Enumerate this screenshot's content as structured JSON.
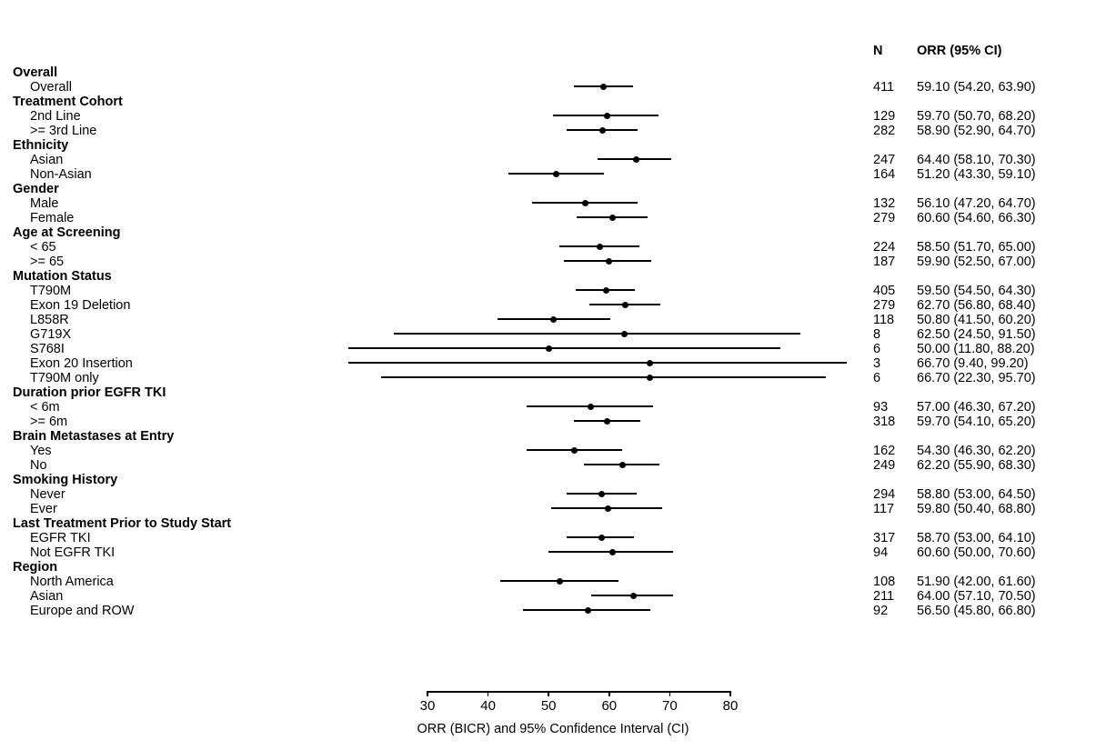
{
  "columns": {
    "n_header": "N",
    "orr_header": "ORR (95% CI)"
  },
  "axis": {
    "title": "ORR (BICR) and 95% Confidence Interval (CI)",
    "ticks": [
      "30",
      "40",
      "50",
      "60",
      "70",
      "80"
    ]
  },
  "chart_data": {
    "type": "forest",
    "title": "",
    "xlabel": "ORR (BICR) and 95% Confidence Interval (CI)",
    "ylabel": "",
    "xlim": [
      30,
      80
    ],
    "xticks": [
      30,
      40,
      50,
      60,
      70,
      80
    ],
    "grid": false,
    "legend": null,
    "columns": [
      "N",
      "ORR (95% CI)"
    ],
    "rows": [
      {
        "type": "group",
        "label": "Overall",
        "n": "",
        "orr_text": "",
        "estimate": null,
        "low": null,
        "high": null
      },
      {
        "type": "item",
        "label": "Overall",
        "n": "411",
        "orr_text": "59.10 (54.20, 63.90)",
        "estimate": 59.1,
        "low": 54.2,
        "high": 63.9
      },
      {
        "type": "group",
        "label": "Treatment Cohort",
        "n": "",
        "orr_text": "",
        "estimate": null,
        "low": null,
        "high": null
      },
      {
        "type": "item",
        "label": "2nd Line",
        "n": "129",
        "orr_text": "59.70 (50.70, 68.20)",
        "estimate": 59.7,
        "low": 50.7,
        "high": 68.2
      },
      {
        "type": "item",
        "label": ">= 3rd Line",
        "n": "282",
        "orr_text": "58.90 (52.90, 64.70)",
        "estimate": 58.9,
        "low": 52.9,
        "high": 64.7
      },
      {
        "type": "group",
        "label": "Ethnicity",
        "n": "",
        "orr_text": "",
        "estimate": null,
        "low": null,
        "high": null
      },
      {
        "type": "item",
        "label": "Asian",
        "n": "247",
        "orr_text": "64.40 (58.10, 70.30)",
        "estimate": 64.4,
        "low": 58.1,
        "high": 70.3
      },
      {
        "type": "item",
        "label": "Non-Asian",
        "n": "164",
        "orr_text": "51.20 (43.30, 59.10)",
        "estimate": 51.2,
        "low": 43.3,
        "high": 59.1
      },
      {
        "type": "group",
        "label": "Gender",
        "n": "",
        "orr_text": "",
        "estimate": null,
        "low": null,
        "high": null
      },
      {
        "type": "item",
        "label": "Male",
        "n": "132",
        "orr_text": "56.10 (47.20, 64.70)",
        "estimate": 56.1,
        "low": 47.2,
        "high": 64.7
      },
      {
        "type": "item",
        "label": "Female",
        "n": "279",
        "orr_text": "60.60 (54.60, 66.30)",
        "estimate": 60.6,
        "low": 54.6,
        "high": 66.3
      },
      {
        "type": "group",
        "label": "Age at Screening",
        "n": "",
        "orr_text": "",
        "estimate": null,
        "low": null,
        "high": null
      },
      {
        "type": "item",
        "label": "< 65",
        "n": "224",
        "orr_text": "58.50 (51.70, 65.00)",
        "estimate": 58.5,
        "low": 51.7,
        "high": 65.0
      },
      {
        "type": "item",
        "label": ">= 65",
        "n": "187",
        "orr_text": "59.90 (52.50, 67.00)",
        "estimate": 59.9,
        "low": 52.5,
        "high": 67.0
      },
      {
        "type": "group",
        "label": "Mutation Status",
        "n": "",
        "orr_text": "",
        "estimate": null,
        "low": null,
        "high": null
      },
      {
        "type": "item",
        "label": "T790M",
        "n": "405",
        "orr_text": "59.50 (54.50, 64.30)",
        "estimate": 59.5,
        "low": 54.5,
        "high": 64.3
      },
      {
        "type": "item",
        "label": "Exon 19 Deletion",
        "n": "279",
        "orr_text": "62.70 (56.80, 68.40)",
        "estimate": 62.7,
        "low": 56.8,
        "high": 68.4
      },
      {
        "type": "item",
        "label": "L858R",
        "n": "118",
        "orr_text": "50.80 (41.50, 60.20)",
        "estimate": 50.8,
        "low": 41.5,
        "high": 60.2
      },
      {
        "type": "item",
        "label": "G719X",
        "n": "8",
        "orr_text": "62.50 (24.50, 91.50)",
        "estimate": 62.5,
        "low": 24.5,
        "high": 91.5
      },
      {
        "type": "item",
        "label": "S768I",
        "n": "6",
        "orr_text": "50.00 (11.80, 88.20)",
        "estimate": 50.0,
        "low": 11.8,
        "high": 88.2
      },
      {
        "type": "item",
        "label": "Exon 20 Insertion",
        "n": "3",
        "orr_text": "66.70 (9.40, 99.20)",
        "estimate": 66.7,
        "low": 9.4,
        "high": 99.2
      },
      {
        "type": "item",
        "label": "T790M only",
        "n": "6",
        "orr_text": "66.70 (22.30, 95.70)",
        "estimate": 66.7,
        "low": 22.3,
        "high": 95.7
      },
      {
        "type": "group",
        "label": "Duration prior EGFR TKI",
        "n": "",
        "orr_text": "",
        "estimate": null,
        "low": null,
        "high": null
      },
      {
        "type": "item",
        "label": "< 6m",
        "n": "93",
        "orr_text": "57.00 (46.30, 67.20)",
        "estimate": 57.0,
        "low": 46.3,
        "high": 67.2
      },
      {
        "type": "item",
        "label": ">= 6m",
        "n": "318",
        "orr_text": "59.70 (54.10, 65.20)",
        "estimate": 59.7,
        "low": 54.1,
        "high": 65.2
      },
      {
        "type": "group",
        "label": "Brain Metastases at Entry",
        "n": "",
        "orr_text": "",
        "estimate": null,
        "low": null,
        "high": null
      },
      {
        "type": "item",
        "label": "Yes",
        "n": "162",
        "orr_text": "54.30 (46.30, 62.20)",
        "estimate": 54.3,
        "low": 46.3,
        "high": 62.2
      },
      {
        "type": "item",
        "label": "No",
        "n": "249",
        "orr_text": "62.20 (55.90, 68.30)",
        "estimate": 62.2,
        "low": 55.9,
        "high": 68.3
      },
      {
        "type": "group",
        "label": "Smoking History",
        "n": "",
        "orr_text": "",
        "estimate": null,
        "low": null,
        "high": null
      },
      {
        "type": "item",
        "label": "Never",
        "n": "294",
        "orr_text": "58.80 (53.00, 64.50)",
        "estimate": 58.8,
        "low": 53.0,
        "high": 64.5
      },
      {
        "type": "item",
        "label": "Ever",
        "n": "117",
        "orr_text": "59.80 (50.40, 68.80)",
        "estimate": 59.8,
        "low": 50.4,
        "high": 68.8
      },
      {
        "type": "group",
        "label": "Last Treatment Prior to Study Start",
        "n": "",
        "orr_text": "",
        "estimate": null,
        "low": null,
        "high": null
      },
      {
        "type": "item",
        "label": "EGFR TKI",
        "n": "317",
        "orr_text": "58.70 (53.00, 64.10)",
        "estimate": 58.7,
        "low": 53.0,
        "high": 64.1
      },
      {
        "type": "item",
        "label": "Not EGFR TKI",
        "n": "94",
        "orr_text": "60.60 (50.00, 70.60)",
        "estimate": 60.6,
        "low": 50.0,
        "high": 70.6
      },
      {
        "type": "group",
        "label": "Region",
        "n": "",
        "orr_text": "",
        "estimate": null,
        "low": null,
        "high": null
      },
      {
        "type": "item",
        "label": "North America",
        "n": "108",
        "orr_text": "51.90 (42.00, 61.60)",
        "estimate": 51.9,
        "low": 42.0,
        "high": 61.6
      },
      {
        "type": "item",
        "label": "Asian",
        "n": "211",
        "orr_text": "64.00 (57.10, 70.50)",
        "estimate": 64.0,
        "low": 57.1,
        "high": 70.5
      },
      {
        "type": "item",
        "label": "Europe and ROW",
        "n": "92",
        "orr_text": "56.50 (45.80, 66.80)",
        "estimate": 56.5,
        "low": 45.8,
        "high": 66.8
      }
    ]
  }
}
